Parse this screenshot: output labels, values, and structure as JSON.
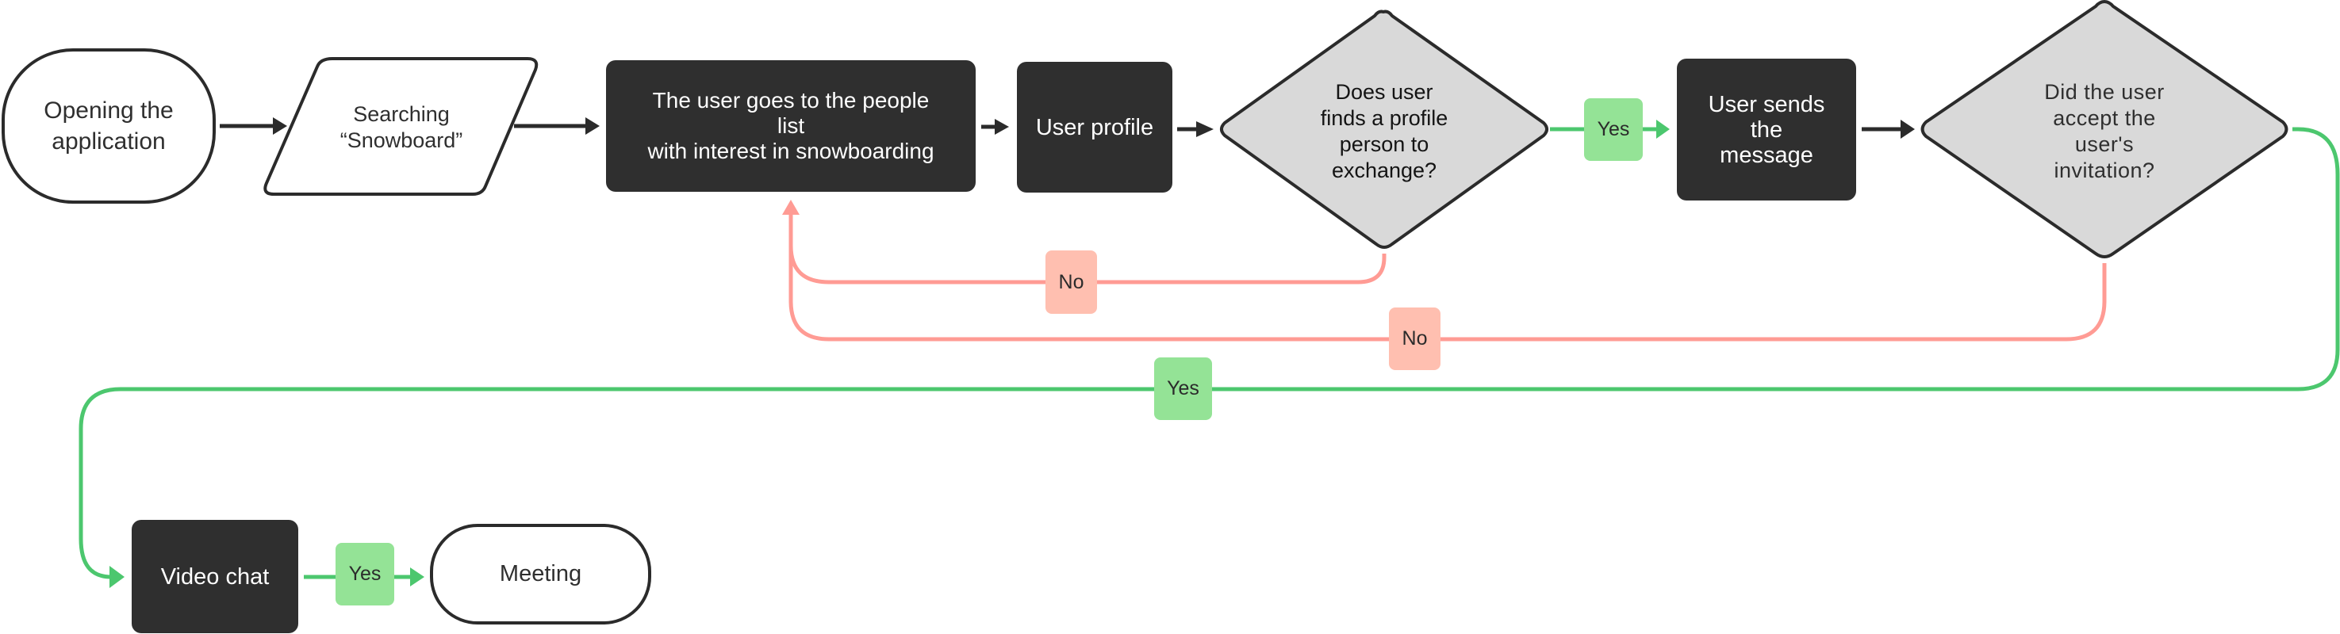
{
  "diagram": {
    "type": "flowchart",
    "colors": {
      "dark_node": "#2f2f2f",
      "decision_fill": "#d9d9d9",
      "stroke": "#2b2b2b",
      "yes_line": "#4cc76e",
      "yes_badge": "#94e396",
      "no_line": "#ff9b94",
      "no_badge": "#ffbfb0"
    },
    "nodes": {
      "start": {
        "shape": "terminal",
        "text": "Opening the\napplication"
      },
      "search": {
        "shape": "input-output",
        "text": "Searching\n“Snowboard”"
      },
      "people_list": {
        "shape": "process",
        "text": "The user goes to the people\nlist\nwith interest in snowboarding"
      },
      "user_profile": {
        "shape": "process",
        "text": "User profile"
      },
      "decision_profile": {
        "shape": "decision",
        "text": "Does user\nfinds a profile\nperson to\nexchange?"
      },
      "send_message": {
        "shape": "process",
        "text": "User sends\nthe\nmessage"
      },
      "decision_invitation": {
        "shape": "decision",
        "text": "Did the user\naccept the\nuser's\ninvitation?"
      },
      "video_chat": {
        "shape": "process",
        "text": "Video chat"
      },
      "meeting": {
        "shape": "terminal",
        "text": "Meeting"
      }
    },
    "edges": [
      {
        "from": "start",
        "to": "search",
        "label": ""
      },
      {
        "from": "search",
        "to": "people_list",
        "label": ""
      },
      {
        "from": "people_list",
        "to": "user_profile",
        "label": ""
      },
      {
        "from": "user_profile",
        "to": "decision_profile",
        "label": ""
      },
      {
        "from": "decision_profile",
        "to": "send_message",
        "label": "Yes"
      },
      {
        "from": "decision_profile",
        "to": "people_list",
        "label": "No"
      },
      {
        "from": "send_message",
        "to": "decision_invitation",
        "label": ""
      },
      {
        "from": "decision_invitation",
        "to": "people_list",
        "label": "No"
      },
      {
        "from": "decision_invitation",
        "to": "video_chat",
        "label": "Yes"
      },
      {
        "from": "video_chat",
        "to": "meeting",
        "label": "Yes"
      }
    ],
    "badges": {
      "yes_profile": "Yes",
      "no_profile": "No",
      "no_invitation": "No",
      "yes_invitation": "Yes",
      "yes_video": "Yes"
    }
  }
}
